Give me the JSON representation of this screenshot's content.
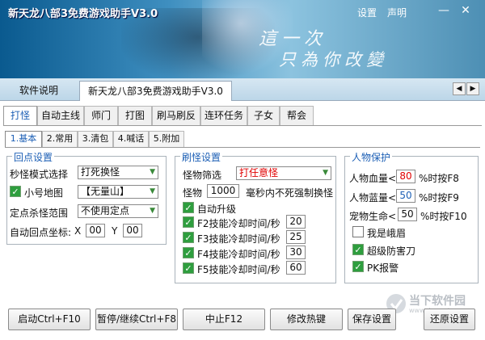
{
  "window": {
    "title": "新天龙八部3免费游戏助手V3.0",
    "settings_link": "设置",
    "declare_link": "声明",
    "minimize_glyph": "—",
    "close_glyph": "✕"
  },
  "banner": {
    "calligraphy_line1": "這一次",
    "calligraphy_line2": "只為你改變"
  },
  "top_tabs": [
    {
      "label": "软件说明",
      "selected": false
    },
    {
      "label": "新天龙八部3免费游戏助手V3.0",
      "selected": true
    }
  ],
  "tab_nav": {
    "left": "◀",
    "right": "▶"
  },
  "main_tabs": [
    {
      "label": "打怪",
      "selected": true
    },
    {
      "label": "自动主线",
      "selected": false
    },
    {
      "label": "师门",
      "selected": false
    },
    {
      "label": "打图",
      "selected": false
    },
    {
      "label": "刷马刷反",
      "selected": false
    },
    {
      "label": "连环任务",
      "selected": false
    },
    {
      "label": "子女",
      "selected": false
    },
    {
      "label": "帮会",
      "selected": false
    }
  ],
  "sub_tabs": [
    {
      "label": "1.基本",
      "selected": true
    },
    {
      "label": "2.常用",
      "selected": false
    },
    {
      "label": "3.清包",
      "selected": false
    },
    {
      "label": "4.喊话",
      "selected": false
    },
    {
      "label": "5.附加",
      "selected": false
    }
  ],
  "return_point": {
    "title": "回点设置",
    "mode_label": "秒怪模式选择",
    "mode_value": "打死换怪",
    "minimap_label": "小号地图",
    "minimap_checked": true,
    "minimap_value": "【无量山】",
    "range_label": "定点杀怪范围",
    "range_value": "不使用定点",
    "coord_label": "自动回点坐标:",
    "x_label": "X",
    "x_value": "00",
    "y_label": "Y",
    "y_value": "00"
  },
  "monster": {
    "title": "刷怪设置",
    "filter_label": "怪物筛选",
    "filter_value": "打任意怪",
    "monster_label": "怪物",
    "monster_value": "1000",
    "monster_suffix": "毫秒内不死强制换怪",
    "auto_upgrade_label": "自动升级",
    "auto_upgrade_checked": true,
    "skills": [
      {
        "label": "F2技能冷却时间/秒",
        "value": "20",
        "checked": true
      },
      {
        "label": "F3技能冷却时间/秒",
        "value": "25",
        "checked": true
      },
      {
        "label": "F4技能冷却时间/秒",
        "value": "30",
        "checked": true
      },
      {
        "label": "F5技能冷却时间/秒",
        "value": "60",
        "checked": true
      }
    ]
  },
  "protect": {
    "title": "人物保护",
    "hp_label": "人物血量<",
    "hp_value": "80",
    "hp_suffix": "%时按F8",
    "mp_label": "人物蓝量<",
    "mp_value": "50",
    "mp_suffix": "%时按F9",
    "pet_label": "宠物生命<",
    "pet_value": "50",
    "pet_suffix": "%时按F10",
    "emei_label": "我是峨眉",
    "emei_checked": false,
    "blade_label": "超级防害刀",
    "blade_checked": true,
    "pk_label": "PK报警",
    "pk_checked": true
  },
  "buttons": {
    "start": "启动Ctrl+F10",
    "pause": "暂停/继续Ctrl+F8",
    "stop": "中止F12",
    "hotkey": "修改热键",
    "save": "保存设置",
    "restore": "还原设置"
  },
  "watermark": {
    "text": "当下软件园",
    "sub": "www.downxia.com"
  },
  "colors": {
    "accent_blue": "#1c5fb5",
    "check_green": "#2e9e3e",
    "alert_red": "#e00000"
  }
}
